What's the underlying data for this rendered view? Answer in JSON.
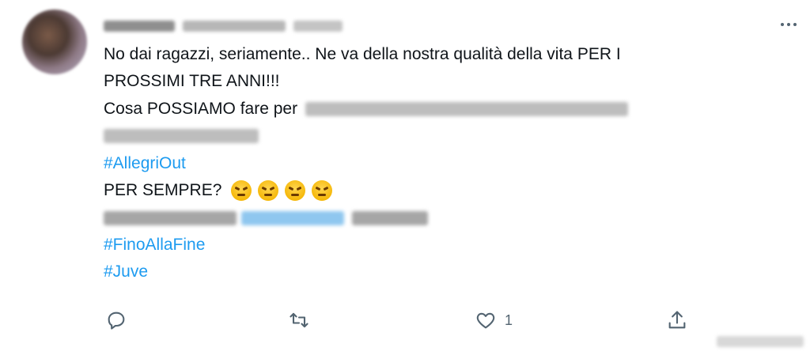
{
  "tweet": {
    "text_lines": {
      "l1": "No dai ragazzi, seriamente.. Ne va della nostra qualità della vita PER I",
      "l2": "PROSSIMI TRE ANNI!!!",
      "l3_prefix": "Cosa POSSIAMO fare per",
      "hashtag_allegri": "#AllegriOut",
      "l6": "PER SEMPRE?",
      "hashtag_fino": "#FinoAllaFine",
      "hashtag_juve": "#Juve"
    },
    "emojis": [
      "angry-face",
      "angry-face",
      "angry-face",
      "angry-face"
    ],
    "colors": {
      "text": "#0f1419",
      "link": "#1d9bf0",
      "icon": "#536471"
    },
    "actions": {
      "reply": "",
      "retweet": "",
      "like_count": "1",
      "share": ""
    }
  }
}
